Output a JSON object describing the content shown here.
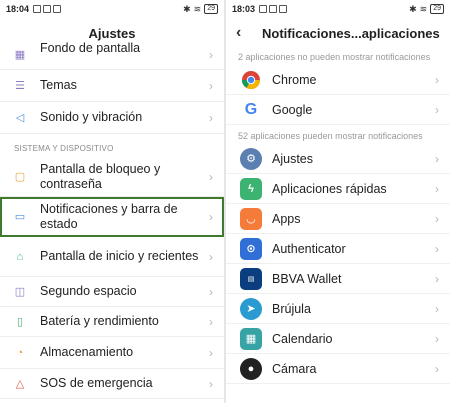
{
  "left": {
    "status_time": "18:04",
    "battery": "29",
    "title": "Ajustes",
    "items_top": [
      {
        "label": "Fondo de pantalla",
        "icon": "wallpaper-icon"
      },
      {
        "label": "Temas",
        "icon": "themes-icon"
      },
      {
        "label": "Sonido y vibración",
        "icon": "sound-icon"
      }
    ],
    "section_label": "SISTEMA Y DISPOSITIVO",
    "items_system": [
      {
        "label": "Pantalla de bloqueo y contraseña",
        "icon": "lock-screen-icon"
      },
      {
        "label": "Notificaciones y barra de estado",
        "icon": "notifications-icon"
      },
      {
        "label": "Pantalla de inicio y recientes",
        "icon": "home-icon"
      },
      {
        "label": "Segundo espacio",
        "icon": "second-space-icon"
      },
      {
        "label": "Batería y rendimiento",
        "icon": "battery-icon"
      },
      {
        "label": "Almacenamiento",
        "icon": "storage-icon"
      },
      {
        "label": "SOS de emergencia",
        "icon": "sos-icon"
      }
    ]
  },
  "right": {
    "status_time": "18:03",
    "battery": "29",
    "title": "Notificaciones...aplicaciones",
    "blocked_note": "2 aplicaciones no pueden mostrar notificaciones",
    "blocked_apps": [
      {
        "label": "Chrome",
        "icon": "chrome-icon",
        "color": "#db4437"
      },
      {
        "label": "Google",
        "icon": "google-icon",
        "color": "#4285f4"
      }
    ],
    "allowed_note": "52 aplicaciones pueden mostrar notificaciones",
    "allowed_apps": [
      {
        "label": "Ajustes",
        "icon": "settings-gear-icon",
        "color": "#5b7fb0"
      },
      {
        "label": "Aplicaciones rápidas",
        "icon": "quick-apps-icon",
        "color": "#3cb371"
      },
      {
        "label": "Apps",
        "icon": "apps-bag-icon",
        "color": "#f47b3a"
      },
      {
        "label": "Authenticator",
        "icon": "authenticator-icon",
        "color": "#2f6fd6"
      },
      {
        "label": "BBVA Wallet",
        "icon": "bbva-wallet-icon",
        "color": "#0b3e7e"
      },
      {
        "label": "Brújula",
        "icon": "compass-icon",
        "color": "#2a9bd0"
      },
      {
        "label": "Calendario",
        "icon": "calendar-icon",
        "color": "#38a3a5"
      },
      {
        "label": "Cámara",
        "icon": "camera-icon",
        "color": "#222222"
      }
    ]
  }
}
